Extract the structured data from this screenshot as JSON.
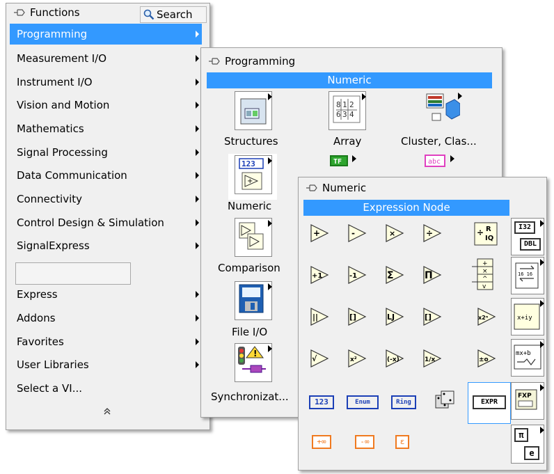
{
  "functions_palette": {
    "title": "Functions",
    "search_label": "Search",
    "items": [
      {
        "label": "Programming",
        "selected": true
      },
      {
        "label": "Measurement I/O"
      },
      {
        "label": "Instrument I/O"
      },
      {
        "label": "Vision and Motion"
      },
      {
        "label": "Mathematics"
      },
      {
        "label": "Signal Processing"
      },
      {
        "label": "Data Communication"
      },
      {
        "label": "Connectivity"
      },
      {
        "label": "Control Design & Simulation"
      },
      {
        "label": "SignalExpress"
      }
    ],
    "items2": [
      {
        "label": "Express"
      },
      {
        "label": "Addons"
      },
      {
        "label": "Favorites"
      },
      {
        "label": "User Libraries"
      },
      {
        "label": "Select a VI..."
      }
    ],
    "collapse": "≈"
  },
  "programming_palette": {
    "title": "Programming",
    "bar": "Numeric",
    "labels": {
      "structures": "Structures",
      "array": "Array",
      "cluster": "Cluster, Clas...",
      "numeric": "Numeric",
      "comparison": "Comparison",
      "fileio": "File I/O",
      "sync": "Synchronizat..."
    },
    "icon_text": {
      "numeric_123": "123",
      "bool_tf": "TF",
      "string_abc": "abc"
    }
  },
  "numeric_palette": {
    "title": "Numeric",
    "bar": "Expression Node",
    "ctrl_labels": {
      "num": "123",
      "enum": "Enum",
      "ring": "Ring",
      "expr": "EXPR",
      "i32": "I32",
      "dbl": "DBL",
      "fxp": "FXP",
      "pinf": "+∞",
      "ninf": "-∞",
      "eps": "ε",
      "pi": "π",
      "e": "e"
    }
  }
}
